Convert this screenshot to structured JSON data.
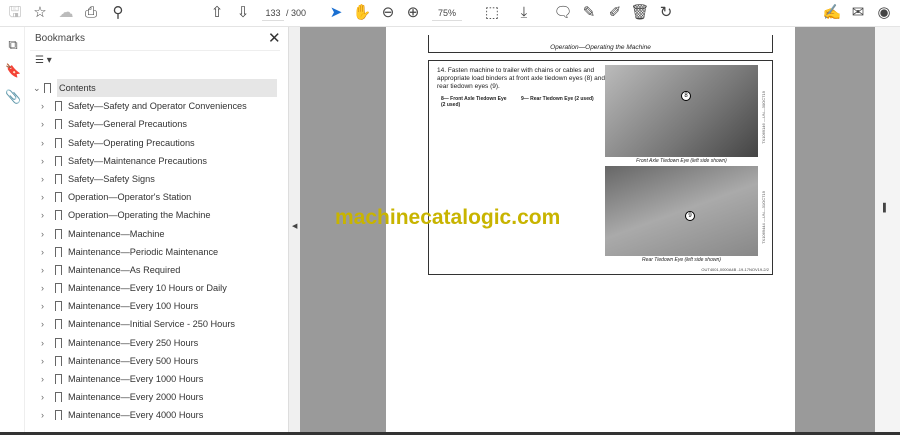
{
  "toolbar": {
    "page_current": "133",
    "page_total": "/ 300",
    "zoom": "75%"
  },
  "bookmarks": {
    "title": "Bookmarks",
    "close": "✕",
    "items": [
      "Contents",
      "Safety—Safety and Operator Conveniences",
      "Safety—General Precautions",
      "Safety—Operating Precautions",
      "Safety—Maintenance Precautions",
      "Safety—Safety Signs",
      "Operation—Operator's Station",
      "Operation—Operating the Machine",
      "Maintenance—Machine",
      "Maintenance—Periodic Maintenance",
      "Maintenance—As Required",
      "Maintenance—Every 10 Hours or Daily",
      "Maintenance—Every 100 Hours",
      "Maintenance—Initial Service - 250 Hours",
      "Maintenance—Every 250 Hours",
      "Maintenance—Every 500 Hours",
      "Maintenance—Every 1000 Hours",
      "Maintenance—Every 2000 Hours",
      "Maintenance—Every 4000 Hours"
    ]
  },
  "document": {
    "header": "Operation—Operating the Machine",
    "step": "14. Fasten machine to trailer with chains or cables and appropriate load binders at front axle tiedown eyes (8) and rear tiedown eyes (9).",
    "legend_8": "8— Front Axle Tiedown Eye (2 used)",
    "legend_9": "9— Rear Tiedown Eye (2 used)",
    "caption_1": "Front Axle Tiedown Eye (left side shown)",
    "caption_2": "Rear Tiedown Eye (left side shown)",
    "callout_1": "8",
    "callout_2": "9",
    "side_1": "TX1069146 —UN—30OCT19",
    "side_2": "TX1069444 —UN—31OCT19",
    "footer": "OUT4001,0000A4B -19-17NOV19-2/2"
  },
  "watermark": "machinecatalogic.com"
}
